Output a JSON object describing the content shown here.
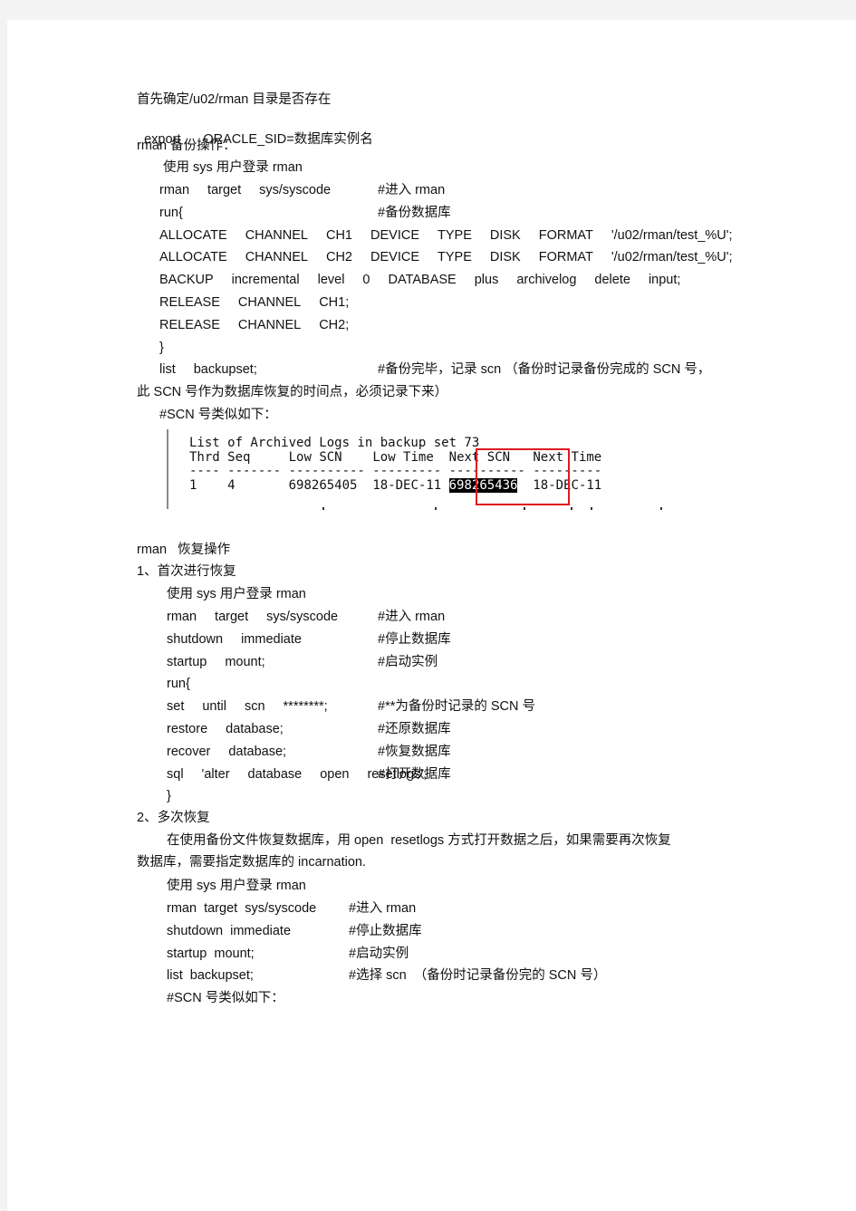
{
  "doc": {
    "intro": {
      "line1": "首先确定/u02/rman 目录是否存在",
      "line2_cmd": "export",
      "line2_arg": "ORACLE_SID=数据库实例名",
      "line3": "rman 备份操作："
    },
    "backup": {
      "login": "使用 sys 用户登录 rman",
      "lines": [
        {
          "code": [
            "rman",
            "target",
            "sys/syscode"
          ],
          "comment": "#进入 rman"
        },
        {
          "code": [
            "run{"
          ],
          "comment": "#备份数据库"
        },
        {
          "code": [
            "ALLOCATE",
            "CHANNEL",
            "CH1",
            "DEVICE",
            "TYPE",
            "DISK",
            "FORMAT",
            "'/u02/rman/test_%U';"
          ],
          "comment": ""
        },
        {
          "code": [
            "ALLOCATE",
            "CHANNEL",
            "CH2",
            "DEVICE",
            "TYPE",
            "DISK",
            "FORMAT",
            "'/u02/rman/test_%U';"
          ],
          "comment": ""
        },
        {
          "code": [
            "BACKUP",
            "incremental",
            "level",
            "0",
            "DATABASE",
            "plus",
            "archivelog",
            "delete",
            "input;"
          ],
          "comment": ""
        },
        {
          "code": [
            "RELEASE",
            "CHANNEL",
            "CH1;"
          ],
          "comment": ""
        },
        {
          "code": [
            "RELEASE",
            "CHANNEL",
            "CH2;"
          ],
          "comment": ""
        },
        {
          "code": [
            "}"
          ],
          "comment": ""
        },
        {
          "code": [
            "list",
            "backupset;"
          ],
          "comment": "#备份完毕，记录 scn （备份时记录备份完成的 SCN 号，"
        }
      ],
      "wrap_line": "此 SCN 号作为数据库恢复的时间点，必须记录下来）",
      "scn_note": "#SCN 号类似如下："
    },
    "terminal": {
      "title": "List of Archived Logs in backup set 73",
      "headers": [
        "Thrd",
        "Seq",
        "Low SCN",
        "Low Time",
        "Next SCN",
        "Next Time"
      ],
      "separator": "---- ------- ---------- --------- ---------- ---------",
      "row": {
        "thrd": "1",
        "seq": "4",
        "low_scn": "698265405",
        "low_time": "18-DEC-11",
        "next_scn": "698265436",
        "next_time": "18-DEC-11"
      },
      "highlight_color": "#e0191e"
    },
    "restore": {
      "title": "rman   恢复操作",
      "section1": {
        "heading": "1、首次进行恢复",
        "login": "使用 sys 用户登录 rman",
        "lines": [
          {
            "code": [
              "rman",
              "target",
              "sys/syscode"
            ],
            "comment": "#进入 rman"
          },
          {
            "code": [
              "shutdown",
              "immediate"
            ],
            "comment": "#停止数据库"
          },
          {
            "code": [
              "startup",
              "mount;"
            ],
            "comment": "#启动实例"
          },
          {
            "code": [
              "run{"
            ],
            "comment": ""
          },
          {
            "code": [
              "set",
              "until",
              "scn",
              "********;"
            ],
            "comment": "#**为备份时记录的 SCN 号"
          },
          {
            "code": [
              "restore",
              "database;"
            ],
            "comment": "#还原数据库"
          },
          {
            "code": [
              "recover",
              "database;"
            ],
            "comment": "#恢复数据库"
          },
          {
            "code": [
              "sql",
              "'alter",
              "database",
              "open",
              "resetlogs';"
            ],
            "comment": "#打开数据库"
          },
          {
            "code": [
              "}"
            ],
            "comment": ""
          }
        ]
      },
      "section2": {
        "heading": "2、多次恢复",
        "para_line1": "在使用备份文件恢复数据库，用 open  resetlogs 方式打开数据之后，如果需要再次恢复",
        "para_line2": "数据库，需要指定数据库的 incarnation.",
        "login": "使用 sys 用户登录 rman",
        "lines": [
          {
            "code": "rman  target  sys/syscode",
            "comment": "#进入 rman"
          },
          {
            "code": "shutdown  immediate",
            "comment": "#停止数据库"
          },
          {
            "code": "startup  mount;",
            "comment": "#启动实例"
          },
          {
            "code": "list  backupset;",
            "comment": "#选择 scn  （备份时记录备份完的 SCN 号）"
          }
        ],
        "scn_note": "#SCN 号类似如下："
      }
    }
  }
}
